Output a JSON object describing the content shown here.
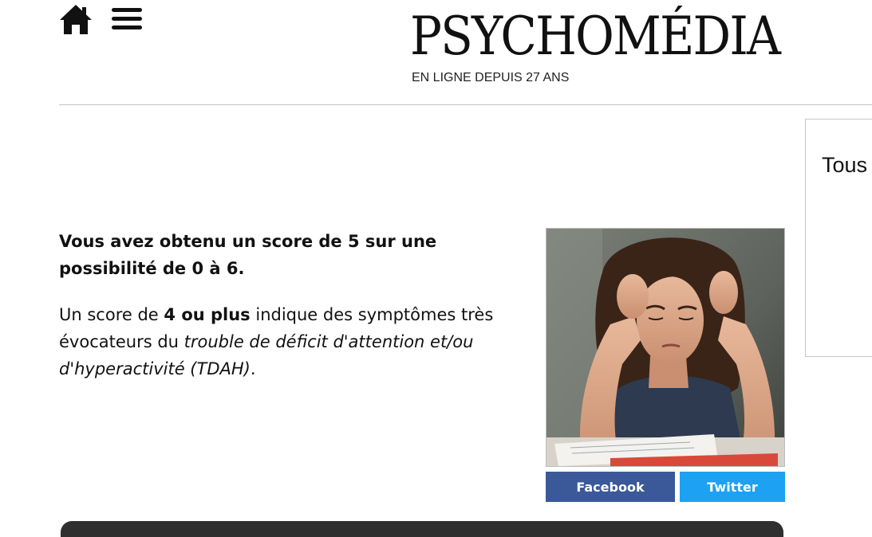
{
  "header": {
    "home_icon": "home-icon",
    "menu_icon": "hamburger-menu-icon",
    "logo_text": "PSYCHOMÉDIA",
    "tagline": "EN LIGNE DEPUIS 27 ANS"
  },
  "side_panel": {
    "title": "Tous"
  },
  "result": {
    "score_text": "Vous avez obtenu un score de 5 sur une possibilité de 0 à 6.",
    "interp_prefix": "Un score de ",
    "interp_bold": "4 ou plus",
    "interp_middle": " indique des symptômes très évocateurs du ",
    "interp_italic": "trouble de déficit d'attention et/ou d'hyperactivité (TDAH)",
    "interp_suffix": "."
  },
  "image": {
    "icon": "stressed-student-photo"
  },
  "share": {
    "facebook_label": "Facebook",
    "twitter_label": "Twitter"
  },
  "colors": {
    "facebook": "#3b5998",
    "twitter": "#1da1f2",
    "divider": "#c4c4c4",
    "bottom_bar": "#2f2f2f"
  }
}
